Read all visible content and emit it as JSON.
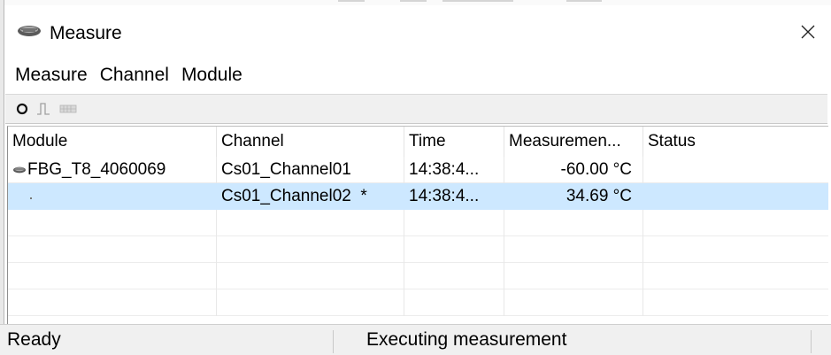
{
  "window": {
    "title": "Measure",
    "icon": "module-icon",
    "close_glyph": "✕"
  },
  "menu": [
    {
      "label": "Measure"
    },
    {
      "label": "Channel"
    },
    {
      "label": "Module"
    }
  ],
  "toolbar": {
    "buttons": [
      {
        "icon": "start-circle-icon"
      },
      {
        "icon": "pulse-icon"
      },
      {
        "icon": "grid-icon"
      }
    ]
  },
  "table": {
    "columns": [
      "Module",
      "Channel",
      "Time",
      "Measuremen...",
      "Status"
    ],
    "rows": [
      {
        "module": "FBG_T8_4060069",
        "channel": "Cs01_Channel01",
        "time": "14:38:4...",
        "measurement": "-60.00 °C",
        "status": "",
        "selected": false
      },
      {
        "module": "",
        "channel": "Cs01_Channel02  *",
        "time": "14:38:4...",
        "measurement": "34.69 °C",
        "status": "",
        "selected": true
      }
    ]
  },
  "statusbar": {
    "left": "Ready",
    "center": "Executing measurement"
  },
  "colors": {
    "selection": "#cde8ff",
    "chrome": "#f0f0f0"
  }
}
